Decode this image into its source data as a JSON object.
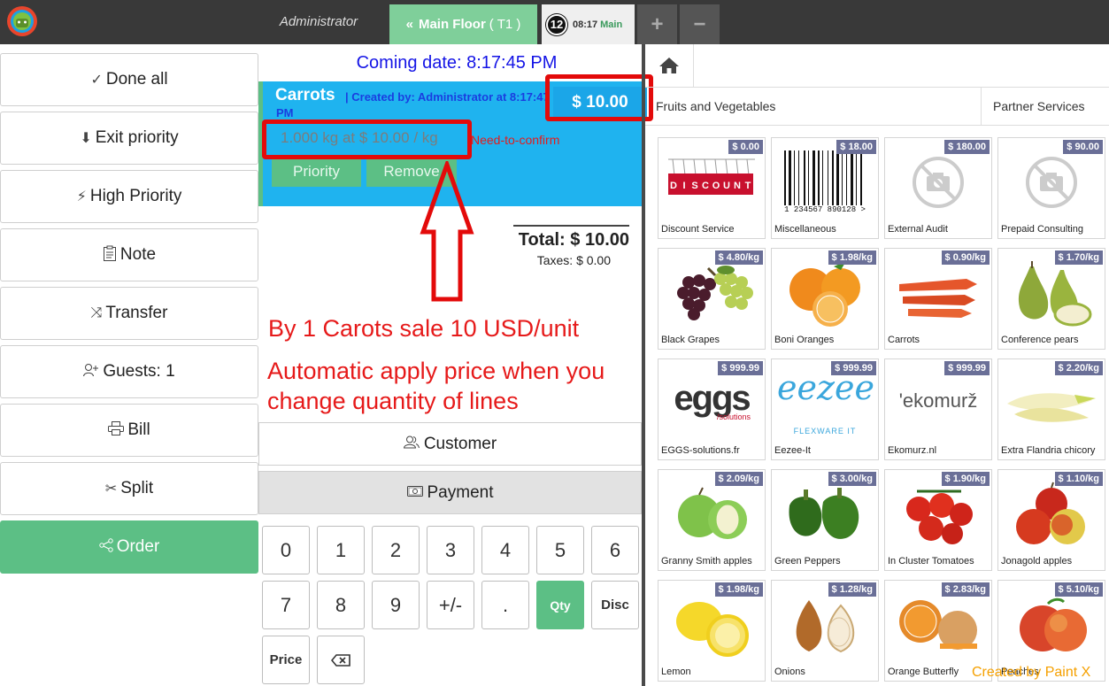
{
  "header": {
    "cashier": "Administrator",
    "floor_tab": "Main Floor",
    "floor_table": "( T1 )",
    "order_number": "12",
    "order_time": "08:17",
    "order_name": "Main",
    "add_tab": "+",
    "remove_tab": "−"
  },
  "actions": [
    {
      "icon": "check-circle-icon",
      "glyph": "✓",
      "label": "Done all"
    },
    {
      "icon": "arrow-down-circle-icon",
      "glyph": "⬇",
      "label": "Exit priority"
    },
    {
      "icon": "lightning-icon",
      "glyph": "⚡",
      "label": "High Priority"
    },
    {
      "icon": "clipboard-icon",
      "glyph": "📋",
      "label": "Note"
    },
    {
      "icon": "shuffle-icon",
      "glyph": "⤨",
      "label": "Transfer"
    },
    {
      "icon": "add-user-icon",
      "glyph": "👤",
      "label": "Guests: 1"
    },
    {
      "icon": "printer-icon",
      "glyph": "🖶",
      "label": "Bill"
    },
    {
      "icon": "scissors-icon",
      "glyph": "✂",
      "label": "Split"
    },
    {
      "icon": "share-icon",
      "glyph": "⋖",
      "label": "Order"
    }
  ],
  "order": {
    "coming_date": "Coming date: 8:17:45 PM",
    "line": {
      "product": "Carrots",
      "created_by": "| Created by: Administrator at 8:17:47 PM",
      "price": "$ 10.00",
      "quantity": "1.000",
      "unit": "kg at",
      "unit_price": "$ 10.00 / kg",
      "status": "Need-to-confirm",
      "priority_button": "Priority",
      "remove_button": "Remove"
    },
    "total": "Total: $ 10.00",
    "taxes": "Taxes: $ 0.00"
  },
  "annotations": {
    "line1": "By 1 Carots sale 10 USD/unit",
    "line2": "Automatic apply price when you change quantity of lines"
  },
  "buttons": {
    "customer": "Customer",
    "payment": "Payment"
  },
  "numpad": {
    "row1": [
      "0",
      "1",
      "2",
      "3",
      "4",
      "5",
      "6"
    ],
    "row2": [
      "7",
      "8",
      "9",
      "+/-",
      ".",
      "Qty",
      "Disc"
    ],
    "row3": [
      "Price",
      "⌫"
    ],
    "active_mode": "Qty"
  },
  "categories": {
    "home_icon": "home-icon",
    "fruits": "Fruits and Vegetables",
    "partner": "Partner Services"
  },
  "products": [
    {
      "name": "Discount Service",
      "price": "$ 0.00",
      "image": "discount-tag-image"
    },
    {
      "name": "Miscellaneous",
      "price": "$ 18.00",
      "image": "barcode-image",
      "barcode_text": "1 234567 890128 >"
    },
    {
      "name": "External Audit",
      "price": "$ 180.00",
      "image": "no-image-camera-icon"
    },
    {
      "name": "Prepaid Consulting",
      "price": "$ 90.00",
      "image": "no-image-camera-icon"
    },
    {
      "name": "Black Grapes",
      "price": "$ 4.80/kg",
      "image": "grapes-image"
    },
    {
      "name": "Boni Oranges",
      "price": "$ 1.98/kg",
      "image": "oranges-image"
    },
    {
      "name": "Carrots",
      "price": "$ 0.90/kg",
      "image": "carrots-image"
    },
    {
      "name": "Conference pears",
      "price": "$ 1.70/kg",
      "image": "pears-image"
    },
    {
      "name": "EGGS-solutions.fr",
      "price": "$ 999.99",
      "image": "eggs-logo",
      "logo_text": "eggs",
      "logo_sub": "/solutions"
    },
    {
      "name": "Eezee-It",
      "price": "$ 999.99",
      "image": "eezee-logo",
      "logo_text": "eezee",
      "logo_sub": "FLEXWARE IT"
    },
    {
      "name": "Ekomurz.nl",
      "price": "$ 999.99",
      "image": "ekomurz-logo",
      "logo_text": "'ekomurž"
    },
    {
      "name": "Extra Flandria chicory",
      "price": "$ 2.20/kg",
      "image": "chicory-image"
    },
    {
      "name": "Granny Smith apples",
      "price": "$ 2.09/kg",
      "image": "green-apples-image"
    },
    {
      "name": "Green Peppers",
      "price": "$ 3.00/kg",
      "image": "green-peppers-image"
    },
    {
      "name": "In Cluster Tomatoes",
      "price": "$ 1.90/kg",
      "image": "tomatoes-image"
    },
    {
      "name": "Jonagold apples",
      "price": "$ 1.10/kg",
      "image": "red-apples-image"
    },
    {
      "name": "Lemon",
      "price": "$ 1.98/kg",
      "image": "lemon-image"
    },
    {
      "name": "Onions",
      "price": "$ 1.28/kg",
      "image": "onions-image"
    },
    {
      "name": "Orange Butterfly",
      "price": "$ 2.83/kg",
      "image": "orange-butterfly-image"
    },
    {
      "name": "Peaches",
      "price": "$ 5.10/kg",
      "image": "peaches-image"
    }
  ],
  "credit": "Created by Paint X"
}
